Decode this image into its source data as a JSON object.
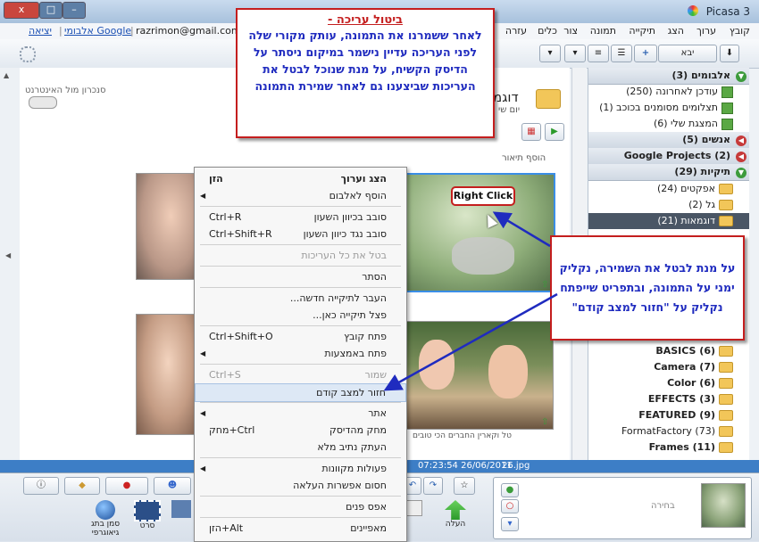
{
  "window": {
    "title": "Picasa 3",
    "close": "x",
    "maximize": "□",
    "minimize": "–"
  },
  "menu": [
    "קובץ",
    "ערוך",
    "הצג",
    "תיקייה",
    "תמונה",
    "צור",
    "כלים",
    "עזרה"
  ],
  "account": {
    "email": "razrimon@gmail.com",
    "my_account": "אלבומי Google",
    "logout": "יציאה"
  },
  "toolbar": {
    "import": "יבא"
  },
  "online_sync": "סנכרון מול האינטרנט",
  "content": {
    "folder_title": "דוגמ",
    "folder_date": "יום שי",
    "add_caption": "הוסף תיאור",
    "thumb_caption": "טל וקארין החברים הכי טובים"
  },
  "sidebar": {
    "albums_header": "אלבומים (3)",
    "albums": [
      "עודכן לאחרונה (250)",
      "תצלומים מסומנים בכוכב (1)",
      "המצגת שלי (6)"
    ],
    "people_header": "אנשים (5)",
    "gp_header": "Google Projects (2)",
    "folders_header": "תיקיות (29)",
    "folders": [
      "אפקטים (24)",
      "גל (2)",
      "דוגמאות (21)"
    ],
    "folders2": [
      "BASICS (6)",
      "(7) Camera",
      "Color (6)",
      "(3) EFFECTS",
      "(9) FEATURED",
      "FormatFactory (73)",
      "(11) Frames"
    ]
  },
  "status": {
    "time": "07:23:54 26/06/2011",
    "file": "26.jpg"
  },
  "bottom": {
    "upload": "העלה",
    "email": "דוא\"ל",
    "print": "הדפס",
    "movie": "סרט",
    "geotag": "סמן בתג גיאוגרפי",
    "selection": "בחירה",
    "export": "יצא"
  },
  "context_menu": [
    {
      "label": "הצג וערוך",
      "shortcut": "הזן",
      "bold": true
    },
    {
      "label": "הוסף לאלבום",
      "shortcut": "",
      "arrow": true
    },
    {
      "sep": true
    },
    {
      "label": "סובב בכיוון השעון",
      "shortcut": "Ctrl+R"
    },
    {
      "label": "סובב נגד כיוון השעון",
      "shortcut": "Ctrl+Shift+R"
    },
    {
      "sep": true
    },
    {
      "label": "בטל את כל העריכות",
      "shortcut": "",
      "disabled": true
    },
    {
      "sep": true
    },
    {
      "label": "הסתר",
      "shortcut": ""
    },
    {
      "sep": true
    },
    {
      "label": "העבר לתיקייה חדשה...",
      "shortcut": ""
    },
    {
      "label": "פצל תיקייה כאן...",
      "shortcut": ""
    },
    {
      "sep": true
    },
    {
      "label": "פתח קובץ",
      "shortcut": "Ctrl+Shift+O"
    },
    {
      "label": "פתח באמצעות",
      "shortcut": "",
      "arrow": true
    },
    {
      "sep": true
    },
    {
      "label": "שמור",
      "shortcut": "Ctrl+S",
      "disabled": true
    },
    {
      "label": "חזור למצב קודם",
      "shortcut": "",
      "highlight": true
    },
    {
      "sep": true
    },
    {
      "label": "אתר",
      "shortcut": "",
      "arrow": true
    },
    {
      "label": "מחק מהדיסק",
      "shortcut": "מחק+Ctrl"
    },
    {
      "label": "העתק נתיב מלא",
      "shortcut": ""
    },
    {
      "sep": true
    },
    {
      "label": "פעולות מקוונות",
      "shortcut": "",
      "arrow": true
    },
    {
      "label": "חסום אפשרות העלאה",
      "shortcut": ""
    },
    {
      "sep": true
    },
    {
      "label": "אפס פנים",
      "shortcut": ""
    },
    {
      "sep": true
    },
    {
      "label": "מאפיינים",
      "shortcut": "הזן+Alt"
    }
  ],
  "annotations": {
    "top_title": "ביטול עריכה -",
    "top_body": "לאחר ששמרנו את התמונה, עותק מקורי שלה לפני העריכה עדיין נישמר במיקום ניסתר על הדיסק הקשיח, על מנת שנוכל לבטל את העריכות שביצענו גם לאחר שמירת התמונה",
    "right_body": "על מנת לבטל את השמירה, נקליק ימני על התמונה, ובתפריט שייפתח נקליק על \"חזור למצב קודם\"",
    "right_click": "Right Click"
  }
}
